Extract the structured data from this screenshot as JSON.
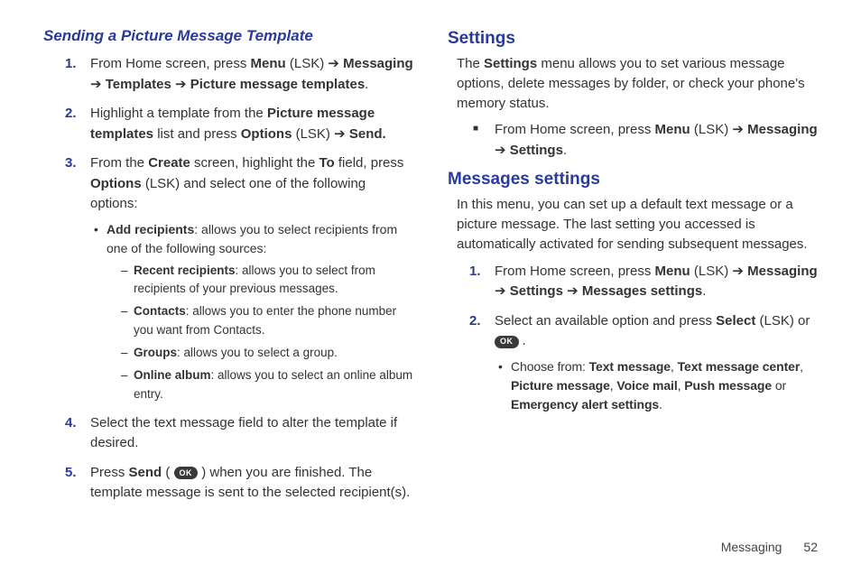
{
  "left": {
    "heading": "Sending a Picture Message Template",
    "steps": [
      {
        "pre": "From Home screen, press ",
        "b1": "Menu",
        "mid1": " (LSK) ",
        "arrow1": "➔",
        "b2": " Messaging ",
        "arrow2": "➔",
        "b3": " Templates ",
        "arrow3": "➔",
        "b4": " Picture message templates",
        "post": "."
      },
      {
        "pre": "Highlight a template from the ",
        "b1": "Picture message templates",
        "mid1": " list and press ",
        "b2": "Options",
        "mid2": " (LSK) ",
        "arrow1": "➔",
        "b3": " Send."
      },
      {
        "pre": "From the ",
        "b1": "Create",
        "mid1": " screen, highlight the ",
        "b2": "To",
        "mid2": " field, press ",
        "b3": "Options",
        "mid3": " (LSK) and select one of the following options:",
        "sub_dot": {
          "b": "Add recipients",
          "text": ": allows you to select recipients from one of the following sources:"
        },
        "sub_dash": [
          {
            "b": "Recent recipients",
            "text": ": allows you to select from recipients of your previous messages."
          },
          {
            "b": "Contacts",
            "text": ": allows you to enter the phone number you want from Contacts."
          },
          {
            "b": "Groups",
            "text": ": allows you to select a group."
          },
          {
            "b": "Online album",
            "text": ": allows you to select an online album entry."
          }
        ]
      },
      {
        "text": "Select the text message field to alter the template if desired."
      },
      {
        "pre": "Press ",
        "b1": "Send",
        "mid1": " ( ",
        "ok": "OK",
        "mid2": " ) when you are finished. The template message is sent to the selected recipient(s)."
      }
    ]
  },
  "right": {
    "settings_heading": "Settings",
    "settings_para_pre": "The ",
    "settings_para_b": "Settings",
    "settings_para_post": " menu allows you to set various message options, delete messages by folder, or check your phone's memory status.",
    "settings_bullet": {
      "pre": "From Home screen, press ",
      "b1": "Menu",
      "mid1": " (LSK) ",
      "arrow1": "➔",
      "b2": " Messaging ",
      "arrow2": "➔",
      "b3": " Settings",
      "post": "."
    },
    "msgset_heading": "Messages settings",
    "msgset_para": "In this menu, you can set up a default text message or a picture message. The last setting you accessed is automatically activated for sending subsequent messages.",
    "msgset_steps": [
      {
        "pre": "From Home screen, press ",
        "b1": "Menu",
        "mid1": " (LSK) ",
        "arrow1": "➔",
        "b2": " Messaging ",
        "arrow2": "➔",
        "b3": " Settings ",
        "arrow3": "➔",
        "b4": " Messages settings",
        "post": "."
      },
      {
        "pre": "Select an available option and press ",
        "b1": "Select",
        "mid1": " (LSK) or  ",
        "ok": "OK",
        "post": " .",
        "sub_dot": {
          "pre": "Choose from: ",
          "parts": [
            "Text message",
            ", ",
            "Text message center",
            ", ",
            "Picture message",
            ", ",
            "Voice mail",
            ", ",
            "Push message",
            " or ",
            "Emergency alert settings",
            "."
          ]
        }
      }
    ]
  },
  "footer": {
    "section": "Messaging",
    "page": "52"
  },
  "nums": [
    "1.",
    "2.",
    "3.",
    "4.",
    "5."
  ]
}
